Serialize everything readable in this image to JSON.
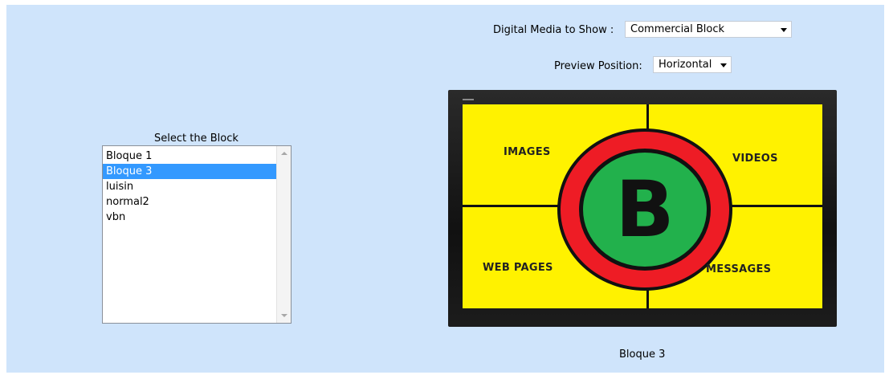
{
  "media": {
    "label": "Digital Media to Show :",
    "selected": "Commercial Block"
  },
  "preview": {
    "label": "Preview Position:",
    "selected": "Horizontal"
  },
  "block_list": {
    "title": "Select the Block",
    "items": [
      "Bloque 1",
      "Bloque 3",
      "luisin",
      "normal2",
      "vbn"
    ],
    "selected": "Bloque 3"
  },
  "screen": {
    "letter": "B",
    "quadrants": {
      "top_left": "IMAGES",
      "top_right": "VIDEOS",
      "bottom_left": "WEB PAGES",
      "bottom_right": "MESSAGES"
    }
  },
  "caption": "Bloque 3",
  "colors": {
    "panel_bg": "#cfe4fb",
    "selection": "#3399ff",
    "screen_yellow": "#fff200",
    "ring_red": "#ee1c25",
    "center_green": "#22b14c"
  }
}
